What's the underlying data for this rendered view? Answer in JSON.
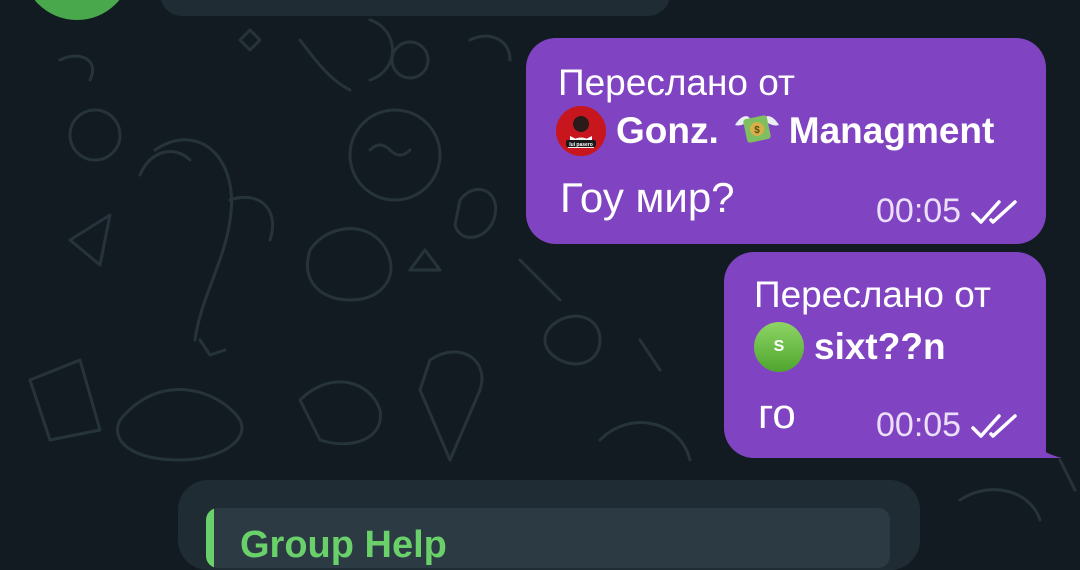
{
  "messages": [
    {
      "forwarded_label": "Переслано от",
      "sender_name": "Gonz.",
      "sender_name_suffix": "Managment",
      "avatar_caption": "lui pasero",
      "text": "Гоу мир?",
      "time": "00:05",
      "status_icon": "double-check-icon"
    },
    {
      "forwarded_label": "Переслано от",
      "sender_name": "sixt??n",
      "avatar_letter": "S",
      "text": "го",
      "time": "00:05",
      "status_icon": "double-check-icon"
    }
  ],
  "incoming_reply": {
    "title": "Group Help"
  },
  "colors": {
    "background": "#121b22",
    "outgoing_bubble": "#8044c2",
    "incoming_bubble": "#1f2c34",
    "accent_green": "#6ad16a"
  }
}
